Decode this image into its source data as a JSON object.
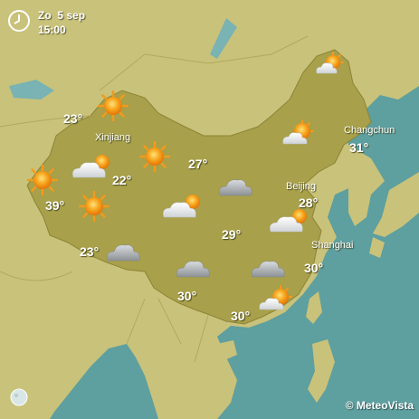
{
  "header": {
    "day": "Zo",
    "date": "5 sep",
    "time": "15:00"
  },
  "credit": "© MeteoVista",
  "colors": {
    "sea": "#5b9c9c",
    "land": "#c9c27a",
    "china": "#a9a04a",
    "text": "#ffffff"
  },
  "cities": [
    {
      "name": "Xinjiang"
    },
    {
      "name": "Changchun"
    },
    {
      "name": "Beijing"
    },
    {
      "name": "Shanghai"
    }
  ],
  "temperatures": [
    "23°",
    "31°",
    "27°",
    "22°",
    "28°",
    "39°",
    "29°",
    "23°",
    "30°",
    "30°",
    "30°"
  ],
  "weather_icons": [
    "sun-icon",
    "sun-icon",
    "sun-icon",
    "sun-icon",
    "partly-cloudy-icon",
    "partly-cloudy-icon",
    "partly-cloudy-icon",
    "partly-cloudy-icon",
    "partly-cloudy-icon",
    "partly-cloudy-icon",
    "cloud-icon",
    "cloud-icon",
    "cloud-icon",
    "cloud-icon"
  ]
}
